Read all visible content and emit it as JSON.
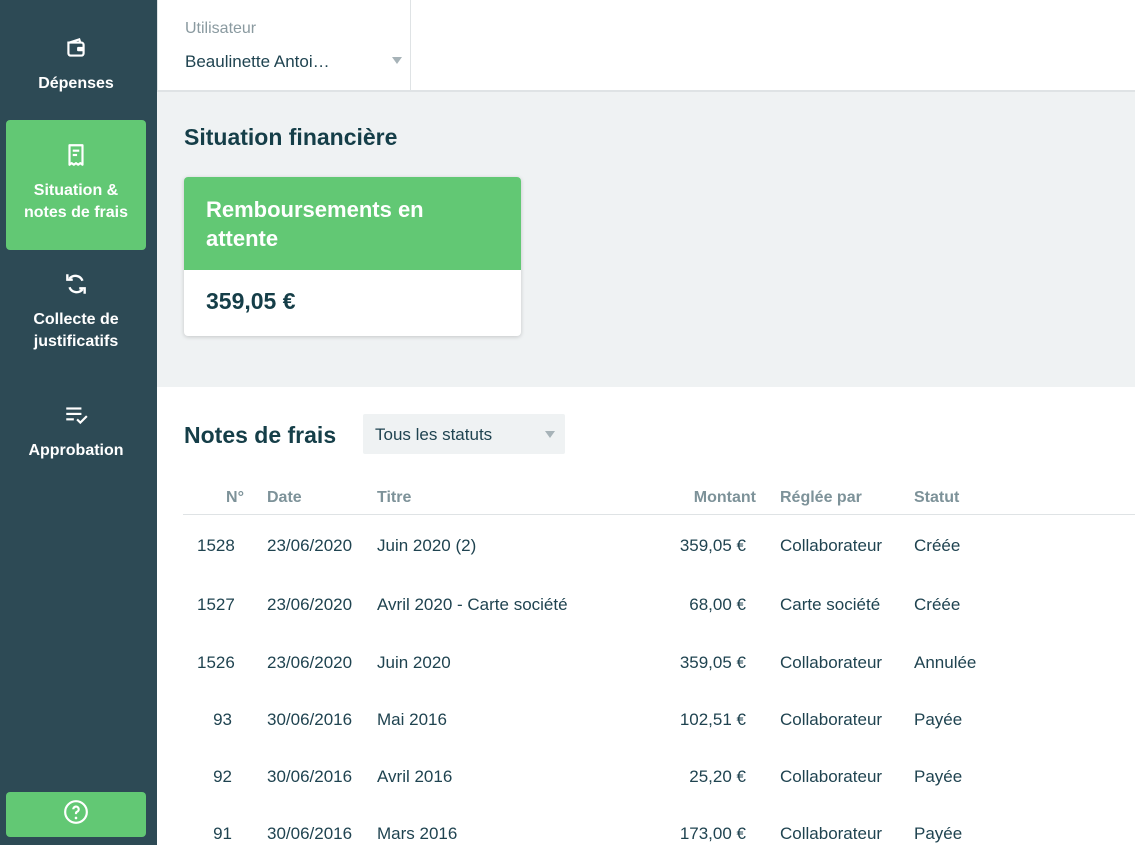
{
  "sidebar": {
    "items": [
      {
        "label": "Dépenses",
        "icon": "wallet-icon"
      },
      {
        "label": "Situation & notes de frais",
        "icon": "receipt-icon",
        "active": true
      },
      {
        "label": "Collecte de justificatifs",
        "icon": "sync-icon"
      },
      {
        "label": "Approbation",
        "icon": "checklist-icon"
      }
    ],
    "help_icon": "help-icon"
  },
  "topbar": {
    "user_label": "Utilisateur",
    "user_value": "Beaulinette Antoi…"
  },
  "finance": {
    "title": "Situation financière",
    "card_title": "Remboursements en attente",
    "card_amount": "359,05 €"
  },
  "notes": {
    "title": "Notes de frais",
    "status_filter": "Tous les statuts",
    "columns": [
      "N°",
      "Date",
      "Titre",
      "Montant",
      "Réglée par",
      "Statut"
    ],
    "rows": [
      {
        "num": "1528",
        "date": "23/06/2020",
        "title": "Juin 2020 (2)",
        "amount": "359,05 €",
        "paid_by": "Collaborateur",
        "status": "Créée"
      },
      {
        "num": "1527",
        "date": "23/06/2020",
        "title": "Avril 2020 - Carte société",
        "amount": "68,00 €",
        "paid_by": "Carte société",
        "status": "Créée"
      },
      {
        "num": "1526",
        "date": "23/06/2020",
        "title": "Juin 2020",
        "amount": "359,05 €",
        "paid_by": "Collaborateur",
        "status": "Annulée"
      },
      {
        "num": "93",
        "date": "30/06/2016",
        "title": "Mai 2016",
        "amount": "102,51 €",
        "paid_by": "Collaborateur",
        "status": "Payée"
      },
      {
        "num": "92",
        "date": "30/06/2016",
        "title": "Avril 2016",
        "amount": "25,20 €",
        "paid_by": "Collaborateur",
        "status": "Payée"
      },
      {
        "num": "91",
        "date": "30/06/2016",
        "title": "Mars 2016",
        "amount": "173,00 €",
        "paid_by": "Collaborateur",
        "status": "Payée"
      }
    ]
  },
  "colors": {
    "sidebar": "#2d4a55",
    "accent": "#62c874",
    "text": "#1f4350",
    "section_bg": "#eff2f3"
  }
}
